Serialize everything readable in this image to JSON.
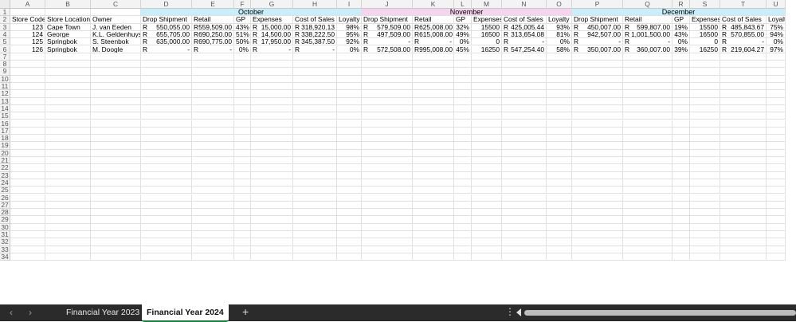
{
  "columns": [
    "A",
    "B",
    "C",
    "D",
    "E",
    "F",
    "G",
    "H",
    "I",
    "J",
    "K",
    "L",
    "M",
    "N",
    "O",
    "P",
    "Q",
    "R",
    "S",
    "T",
    "U"
  ],
  "rows_count": 34,
  "months": [
    {
      "label": "October",
      "color": "#c7eefa"
    },
    {
      "label": "November",
      "color": "#f6d3ee"
    },
    {
      "label": "December",
      "color": "#c7eefa"
    }
  ],
  "headers": [
    "Store Code",
    "Store Location",
    "Owner",
    "Drop Shipment",
    "Retail",
    "GP",
    "Expenses",
    "Cost of Sales",
    "Loyalty",
    "Drop Shipment",
    "Retail",
    "GP",
    "Expenses",
    "Cost of Sales",
    "Loyalty",
    "Drop Shipment",
    "Retail",
    "GP",
    "Expenses",
    "Cost of Sales",
    "Loyalty"
  ],
  "data_rows": [
    [
      "123",
      "Cape Town",
      "J. van Eeden",
      "R|550,055.00",
      "R|559,509.00",
      "43%",
      "R|15,000.00",
      "R|318,920.13",
      "98%",
      "R|579,509.00",
      "R|625,008.00",
      "32%",
      "15500",
      "R|425,005.44",
      "93%",
      "R|450,007.00",
      "R|599,807.00",
      "19%",
      "15500",
      "R|485,843.67",
      "75%"
    ],
    [
      "124",
      "George",
      "K.L. Geldenhuys",
      "R|655,705.00",
      "R|690,250.00",
      "51%",
      "R|14,500.00",
      "R|338,222.50",
      "95%",
      "R|497,509.00",
      "R|615,008.00",
      "49%",
      "16500",
      "R|313,654.08",
      "81%",
      "R|942,507.00",
      "R|1,001,500.00",
      "43%",
      "16500",
      "R|570,855.00",
      "94%"
    ],
    [
      "125",
      "Springbok",
      "S. Steenbok",
      "R|635,000.00",
      "R|690,775.00",
      "50%",
      "R|17,950.00",
      "R|345,387.50",
      "92%",
      "R|-",
      "R|-",
      "0%",
      "0",
      "R|-",
      "0%",
      "R|-",
      "R|-",
      "0%",
      "0",
      "R|-",
      "0%"
    ],
    [
      "126",
      "Springbok",
      "M. Doogle",
      "R|-",
      "R|-",
      "0%",
      "R|-",
      "R|-",
      "0%",
      "R|572,508.00",
      "R|995,008.00",
      "45%",
      "16250",
      "R|547,254.40",
      "58%",
      "R|350,007.00",
      "R|360,007.00",
      "39%",
      "16250",
      "R|219,604.27",
      "97%"
    ]
  ],
  "sheet_tabs": [
    {
      "label": "Financial Year 2023",
      "active": false
    },
    {
      "label": "Financial Year 2024",
      "active": true
    }
  ],
  "add_sheet_label": "+",
  "more_label": "⋮",
  "icons": {
    "prev": "chevron-left-icon",
    "next": "chevron-right-icon"
  }
}
